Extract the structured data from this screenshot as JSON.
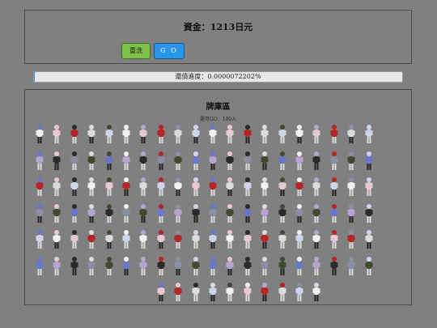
{
  "funds": {
    "label": "資金：",
    "value": "1213",
    "unit": "日元"
  },
  "buttons": {
    "reset": "重洗",
    "go": "G O"
  },
  "progress": {
    "label": "還債進度：",
    "value": "0.0000072202%",
    "fraction": 7.2202e-08
  },
  "card_area": {
    "title": "牌庫區",
    "count_label": "還可GO：",
    "count_value": "100人"
  },
  "cards": {
    "rows": [
      20,
      20,
      20,
      20,
      20,
      20,
      10
    ],
    "palette": [
      "#f1f1f1",
      "#2a2a2a",
      "#cfd5ea",
      "#b7a5cf",
      "#dcdcdc",
      "#6a76c8",
      "#b32626",
      "#3f4a30",
      "#e8c9d3",
      "#8a8fa3"
    ]
  }
}
